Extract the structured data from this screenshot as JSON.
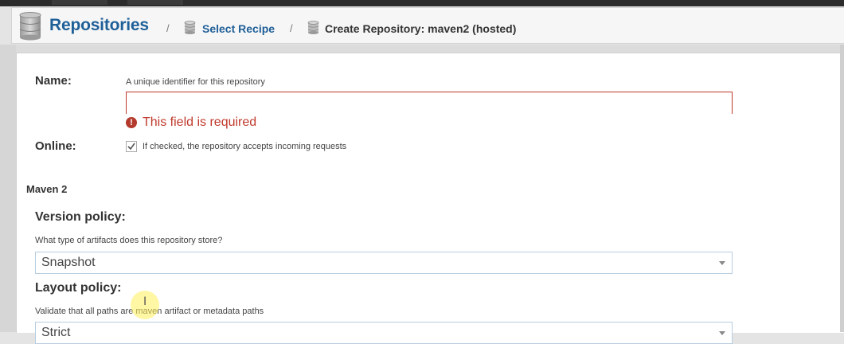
{
  "breadcrumb": {
    "root": "Repositories",
    "separator": "/",
    "step": "Select Recipe",
    "current": "Create Repository: maven2 (hosted)"
  },
  "form": {
    "name": {
      "label": "Name:",
      "help": "A unique identifier for this repository",
      "value": "",
      "error": "This field is required"
    },
    "online": {
      "label": "Online:",
      "checked": true,
      "help": "If checked, the repository accepts incoming requests"
    },
    "section_title": "Maven 2",
    "version_policy": {
      "label": "Version policy:",
      "help": "What type of artifacts does this repository store?",
      "value": "Snapshot"
    },
    "layout_policy": {
      "label": "Layout policy:",
      "help": "Validate that all paths are maven artifact or metadata paths",
      "value": "Strict"
    }
  },
  "colors": {
    "link": "#1f5f98",
    "error": "#c0392b"
  }
}
